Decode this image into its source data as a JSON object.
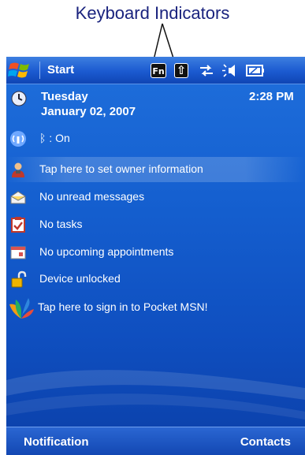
{
  "callout": {
    "label": "Keyboard Indicators"
  },
  "titlebar": {
    "start_label": "Start",
    "indicators": {
      "fn_key": "Fn",
      "shift_key": "⇧",
      "icons": [
        "windows-flag-icon",
        "fn-key-indicator-icon",
        "shift-key-indicator-icon",
        "sync-arrows-icon",
        "speaker-volume-icon",
        "battery-icon"
      ]
    }
  },
  "today": {
    "day": "Tuesday",
    "date": "January 02, 2007",
    "time": "2:28 PM",
    "items": [
      {
        "icon": "wireless-antenna-icon",
        "label": "ᛒ : On"
      },
      {
        "icon": "owner-person-icon",
        "label": "Tap here to set owner information"
      },
      {
        "icon": "envelope-message-icon",
        "label": "No unread messages"
      },
      {
        "icon": "task-checkbox-icon",
        "label": "No tasks"
      },
      {
        "icon": "calendar-icon",
        "label": "No upcoming appointments"
      },
      {
        "icon": "unlocked-padlock-icon",
        "label": "Device unlocked"
      },
      {
        "icon": "msn-butterfly-icon",
        "label": "Tap here to sign in to Pocket MSN!"
      }
    ]
  },
  "softkeys": {
    "left": "Notification",
    "right": "Contacts"
  },
  "colors": {
    "screen_blue": "#1560d0",
    "callout_text": "#1a237e",
    "text": "#ffffff"
  }
}
